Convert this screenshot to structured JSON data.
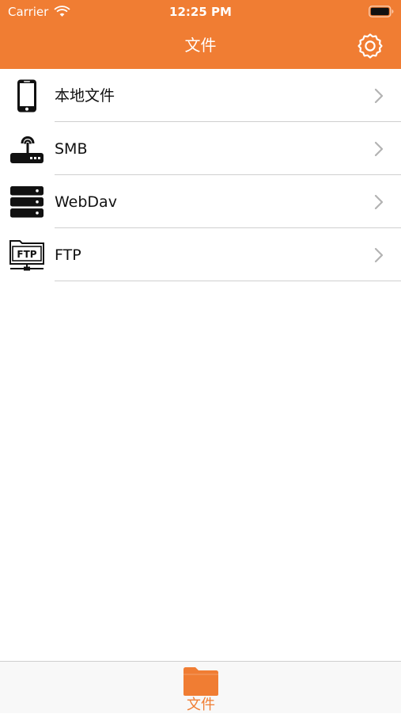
{
  "status_bar": {
    "carrier": "Carrier",
    "time": "12:25 PM",
    "wifi_icon": "wifi-icon",
    "battery_icon": "battery-icon"
  },
  "nav_bar": {
    "title": "文件",
    "settings_icon": "gear-icon",
    "background_color": "#f07d33"
  },
  "list": {
    "items": [
      {
        "label": "本地文件",
        "icon": "phone-icon"
      },
      {
        "label": "SMB",
        "icon": "router-icon"
      },
      {
        "label": "WebDav",
        "icon": "server-icon"
      },
      {
        "label": "FTP",
        "icon": "ftp-icon"
      }
    ],
    "chevron_icon": "chevron-right-icon"
  },
  "tab_bar": {
    "items": [
      {
        "label": "文件",
        "icon": "folder-icon",
        "selected": true
      }
    ],
    "accent_color": "#f07d33"
  }
}
